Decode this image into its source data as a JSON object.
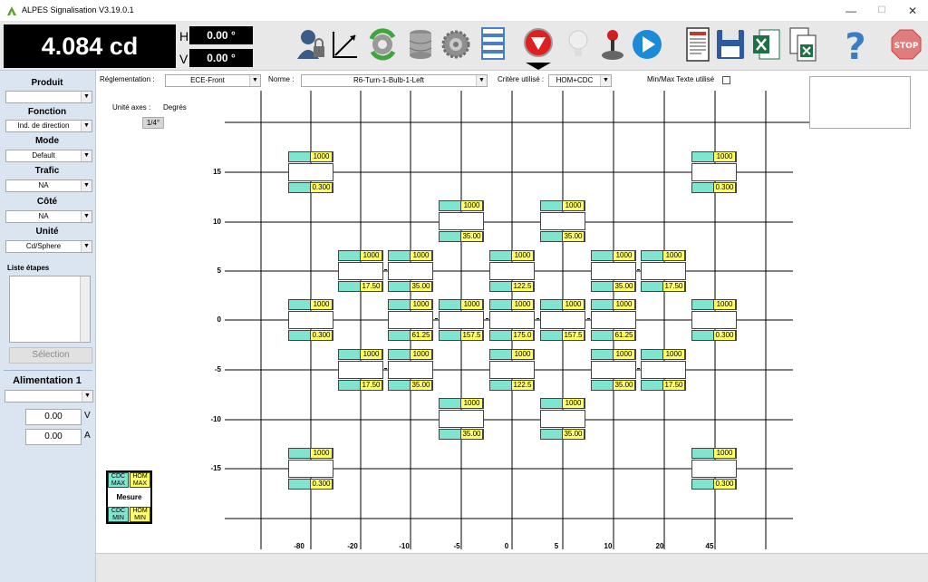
{
  "window": {
    "title": "ALPES Signalisation V3.19.0.1",
    "min": "—",
    "max": "☐",
    "close": "✕"
  },
  "readout": {
    "luminous": "4.084 cd",
    "h_label": "H",
    "h_value": "0.00 °",
    "v_label": "V",
    "v_value": "0.00 °"
  },
  "toolbar_icons": [
    "user-lock-icon",
    "axes-icon",
    "refresh-gear-icon",
    "database-icon",
    "gear-icon",
    "list-icon",
    "record-down-icon",
    "lamp-icon",
    "joystick-icon",
    "play-icon",
    "report-icon",
    "save-icon",
    "excel-icon",
    "excel-copy-icon",
    "help-icon",
    "stop-icon"
  ],
  "sidebar": {
    "produit": {
      "label": "Produit",
      "value": ""
    },
    "fonction": {
      "label": "Fonction",
      "value": "Ind. de direction"
    },
    "mode": {
      "label": "Mode",
      "value": "Default"
    },
    "trafic": {
      "label": "Trafic",
      "value": "NA"
    },
    "cote": {
      "label": "Côté",
      "value": "NA"
    },
    "unite": {
      "label": "Unité",
      "value": "Cd/Sphere"
    },
    "steps_label": "Liste étapes",
    "selection_button": "Sélection",
    "alimentation": {
      "label": "Alimentation 1",
      "value": "",
      "voltage": "0.00",
      "voltage_unit": "V",
      "current": "0.00",
      "current_unit": "A"
    }
  },
  "controls": {
    "reglementation_label": "Réglementation :",
    "reglementation_value": "ECE-Front",
    "norme_label": "Norme :",
    "norme_value": "R6-Turn-1-Bulb-1-Left",
    "critere_label": "Critère utilisé :",
    "critere_value": "HOM+CDC",
    "minmax_label": "Min/Max Texte utilisé"
  },
  "axes": {
    "unit_label": "Unité axes :",
    "unit_value": "Degrés",
    "step_button": "1/4°",
    "y_labels": [
      "15",
      "10",
      "5",
      "0",
      "-5",
      "-10",
      "-15"
    ],
    "x_labels": [
      "-80",
      "-20",
      "-10",
      "-5",
      "0",
      "5",
      "10",
      "20",
      "45"
    ]
  },
  "grid_cells": [
    {
      "top": "1000",
      "bot": "0.300"
    },
    {
      "top": "1000",
      "bot": "0.300"
    },
    {
      "top": "1000",
      "bot": "35.00"
    },
    {
      "top": "1000",
      "bot": "35.00"
    },
    {
      "top": "1000",
      "bot": "17.50"
    },
    {
      "top": "1000",
      "bot": "35.00"
    },
    {
      "top": "1000",
      "bot": "122.5"
    },
    {
      "top": "1000",
      "bot": "35.00"
    },
    {
      "top": "1000",
      "bot": "17.50"
    },
    {
      "top": "1000",
      "bot": "0.300"
    },
    {
      "top": "1000",
      "bot": "61.25"
    },
    {
      "top": "1000",
      "bot": "157.5"
    },
    {
      "top": "1000",
      "bot": "175.0"
    },
    {
      "top": "1000",
      "bot": "157.5"
    },
    {
      "top": "1000",
      "bot": "61.25"
    },
    {
      "top": "1000",
      "bot": "0.300"
    },
    {
      "top": "1000",
      "bot": "17.50"
    },
    {
      "top": "1000",
      "bot": "35.00"
    },
    {
      "top": "1000",
      "bot": "122.5"
    },
    {
      "top": "1000",
      "bot": "35.00"
    },
    {
      "top": "1000",
      "bot": "17.50"
    },
    {
      "top": "1000",
      "bot": "35.00"
    },
    {
      "top": "1000",
      "bot": "35.00"
    },
    {
      "top": "1000",
      "bot": "0.300"
    },
    {
      "top": "1000",
      "bot": "0.300"
    }
  ],
  "legend": {
    "cdc_max": "CDC MAX",
    "hom_max": "HOM MAX",
    "mesure": "Mesure",
    "cdc_min": "CDC MIN",
    "hom_min": "HOM MIN"
  },
  "colors": {
    "cdc": "#7fe5cf",
    "hom": "#ffff66",
    "sidebar": "#dbe5f1"
  }
}
